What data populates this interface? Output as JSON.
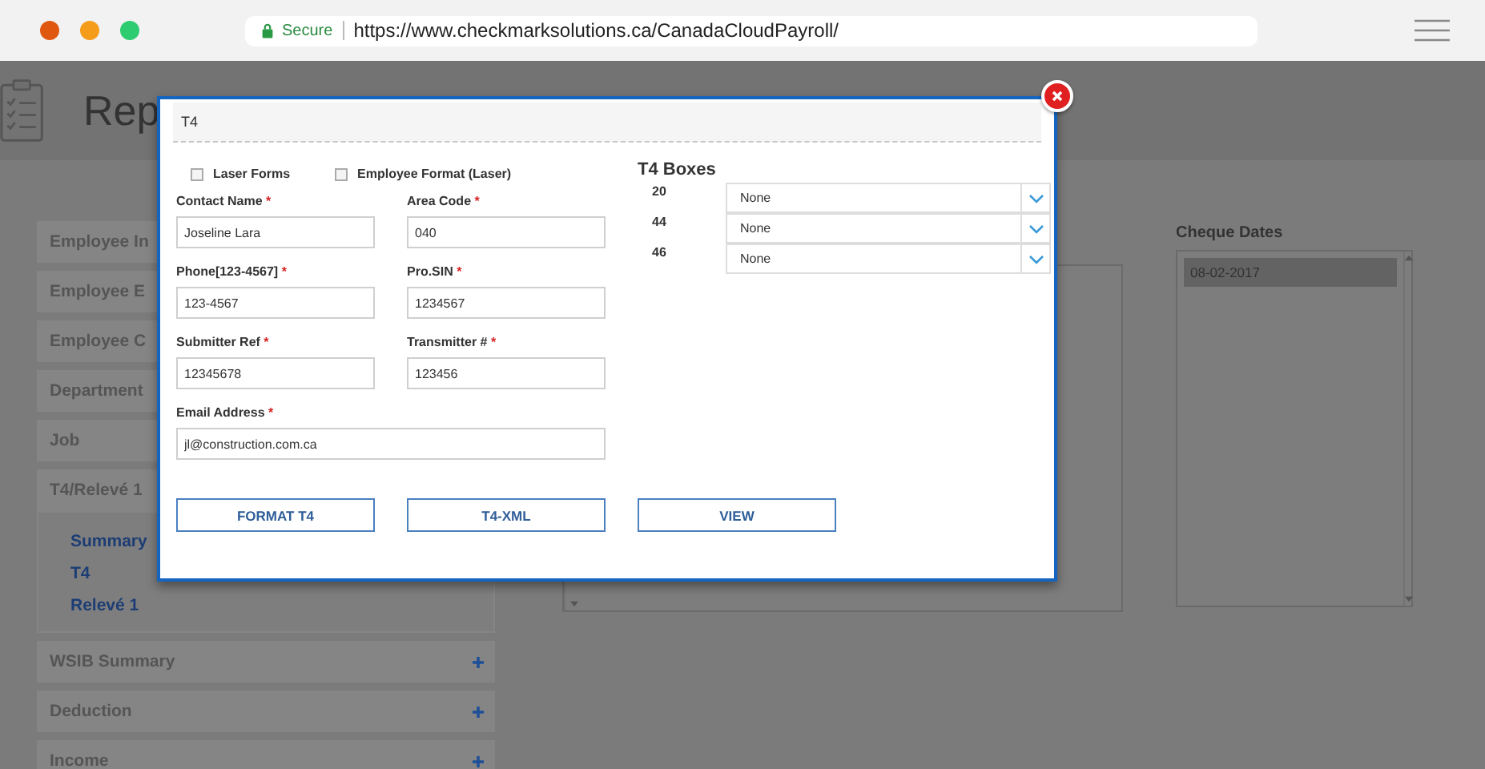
{
  "browser": {
    "secure_label": "Secure",
    "url": "https://www.checkmarksolutions.ca/CanadaCloudPayroll/"
  },
  "page": {
    "title": "Rep",
    "sidebar": [
      {
        "label": "Employee In"
      },
      {
        "label": "Employee E"
      },
      {
        "label": "Employee C"
      },
      {
        "label": "Department"
      },
      {
        "label": "Job"
      },
      {
        "label": "T4/Relevé 1",
        "children": [
          {
            "label": "Summary"
          },
          {
            "label": "T4"
          },
          {
            "label": "Relevé 1"
          }
        ]
      },
      {
        "label": "WSIB Summary"
      },
      {
        "label": "Deduction"
      },
      {
        "label": "Income"
      }
    ],
    "cheque_dates": {
      "title": "Cheque Dates",
      "items": [
        {
          "text": "08-02-2017",
          "selected": true
        }
      ]
    }
  },
  "dialog": {
    "title": "T4",
    "checkboxes": [
      {
        "label": "Laser Forms",
        "checked": false
      },
      {
        "label": "Employee Format (Laser)",
        "checked": false
      }
    ],
    "fields": [
      {
        "label": "Contact Name",
        "mark": "*",
        "value": "Joseline Lara",
        "kind": "half"
      },
      {
        "label": "Area Code",
        "mark": "*",
        "value": "040",
        "kind": "half"
      },
      {
        "label": "Phone[123-4567]",
        "mark": "*",
        "value": "123-4567",
        "kind": "half"
      },
      {
        "label": "Pro.SIN",
        "mark": "*",
        "value": "1234567",
        "kind": "half"
      },
      {
        "label": "Submitter Ref",
        "mark": "*",
        "value": "12345678",
        "kind": "half"
      },
      {
        "label": "Transmitter #",
        "mark": "*",
        "value": "123456",
        "kind": "half"
      },
      {
        "label": "Email Address",
        "mark": "*",
        "value": "jl@construction.com.ca",
        "kind": "full"
      }
    ],
    "t4_boxes": {
      "title": "T4 Boxes",
      "rows": [
        {
          "code": "20",
          "value": "None"
        },
        {
          "code": "44",
          "value": "None"
        },
        {
          "code": "46",
          "value": "None"
        }
      ]
    },
    "buttons": [
      "FORMAT T4",
      "T4-XML",
      "VIEW"
    ]
  }
}
